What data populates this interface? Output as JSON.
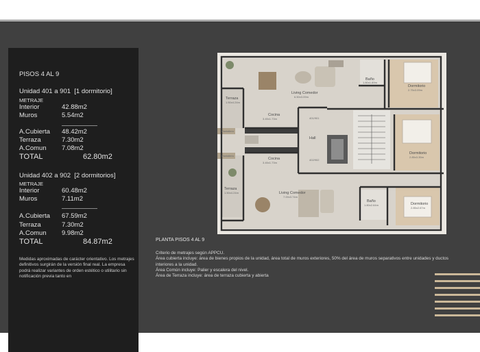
{
  "summary": {
    "title": "PISOS 4 AL 9",
    "unit1": {
      "name_a": "Unidad 401 a 901",
      "name_b": "[1 dormitorio]",
      "metraje_label": "METRAJE",
      "interior_label": "Interior",
      "interior_value": "42.88m2",
      "muros_label": "Muros",
      "muros_value": "5.54m2",
      "cubierta_label": "A.Cubierta",
      "cubierta_value": "48.42m2",
      "terraza_label": "Terraza",
      "terraza_value": "7.30m2",
      "comun_label": "A.Comun",
      "comun_value": "7.08m2",
      "total_label": "TOTAL",
      "total_value": "62.80m2"
    },
    "unit2": {
      "name_a": "Unidad 402 a 902",
      "name_b": "[2 dormitorios]",
      "metraje_label": "METRAJE",
      "interior_label": "Interior",
      "interior_value": "60.48m2",
      "muros_label": "Muros",
      "muros_value": "7.11m2",
      "cubierta_label": "A.Cubierta",
      "cubierta_value": "67.59m2",
      "terraza_label": "Terraza",
      "terraza_value": "7.30m2",
      "comun_label": "A.Comun",
      "comun_value": "9.98m2",
      "total_label": "TOTAL",
      "total_value": "84.87m2"
    },
    "notes": "Medidas aproximadas de carácter orientativo. Los metrajes definitivos surgirán de la versión final real. La empresa podrá realizar variantes de orden estético o utilitario sin notificación previa tanto en"
  },
  "caption": "PLANTA PISOS 4 AL 9",
  "criteria": [
    "Criterio de metrajes según APPCU.",
    "Área cubierta incluye: área de bienes propios de la unidad, área total de muros exteriores, 50% del área de muros separativos entre unidades y ductos interiores a la unidad.",
    "Área Común incluye: Palier y escalera del nivel.",
    "Área de Terraza incluye: área de terraza cubierta y abierta"
  ],
  "plan_labels": {
    "terraza_top": "Terraza",
    "terraza_top_dim": "1.50x4.24m",
    "living_top": "Living Comedor",
    "living_top_dim": "6.50x3.09m",
    "bano_top": "Baño",
    "bano_top_dim": "1.80x1.89m",
    "dorm_top": "Dormitorio",
    "dorm_top_dim": "2.75x3.09m",
    "cocina_top": "Cocina",
    "cocina_top_dim": "3.45x1.73m",
    "unit_401": "401/901",
    "pantallero_top": "Pantallero",
    "hall": "Hall",
    "dorm_mid": "Dormitorio",
    "dorm_mid_dim": "2.85x3.35m",
    "pantallero_bottom": "Pantallero",
    "cocina_bottom": "Cocina",
    "cocina_bottom_dim": "3.45x1.73m",
    "unit_402": "402/902",
    "terraza_bottom": "Terraza",
    "terraza_bottom_dim": "1.50x4.24m",
    "living_bottom": "Living Comedor",
    "living_bottom_dim": "7.00x3.74m",
    "bano_bottom": "Baño",
    "bano_bottom_dim": "1.80x2.64m",
    "dorm_bottom": "Dormitorio",
    "dorm_bottom_dim": "2.85x2.67m"
  }
}
